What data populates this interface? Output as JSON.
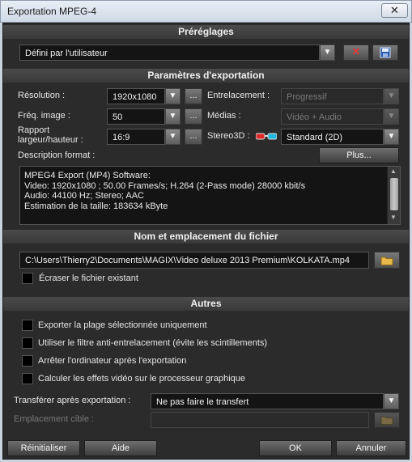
{
  "window": {
    "title": "Exportation MPEG-4",
    "close": "✕"
  },
  "presets": {
    "section": "Préréglages",
    "value": "Défini par l'utilisateur"
  },
  "params": {
    "section": "Paramètres d'exportation",
    "resolution_label": "Résolution :",
    "resolution_value": "1920x1080",
    "framerate_label": "Fréq. image :",
    "framerate_value": "50",
    "ratio_label": "Rapport largeur/hauteur :",
    "ratio_value": "16:9",
    "interlace_label": "Entrelacement :",
    "interlace_value": "Progressif",
    "media_label": "Médias :",
    "media_value": "Vidéo + Audio",
    "stereo_label": "Stereo3D :",
    "stereo_value": "Standard (2D)",
    "desc_label": "Description format :",
    "more_button": "Plus...",
    "ellipsis": "...",
    "description_lines": [
      "MPEG4 Export (MP4) Software:",
      "Video: 1920x1080 ; 50.00 Frames/s; H.264 (2-Pass mode) 28000 kbit/s",
      "Audio: 44100 Hz; Stereo;  AAC",
      "Estimation de la taille: 183634 kByte"
    ]
  },
  "file": {
    "section": "Nom et emplacement du fichier",
    "path": "C:\\Users\\Thierry2\\Documents\\MAGIX\\Video deluxe 2013 Premium\\KOLKATA.mp4",
    "overwrite_label": "Écraser le fichier existant"
  },
  "others": {
    "section": "Autres",
    "options": [
      "Exporter la plage sélectionnée uniquement",
      "Utiliser le filtre anti-entrelacement (évite les scintillements)",
      "Arrêter l'ordinateur après l'exportation",
      "Calculer les effets vidéo sur le processeur graphique"
    ],
    "transfer_label": "Transférer après exportation :",
    "transfer_value": "Ne pas faire le transfert",
    "target_label": "Emplacement cible :"
  },
  "footer": {
    "reset": "Réinitialiser",
    "help": "Aide",
    "ok": "OK",
    "cancel": "Annuler"
  },
  "icons": {
    "dropdown": "▼",
    "folder": "folder-icon",
    "delete": "delete-icon",
    "save": "save-icon",
    "glasses": "3d-glasses-icon"
  }
}
